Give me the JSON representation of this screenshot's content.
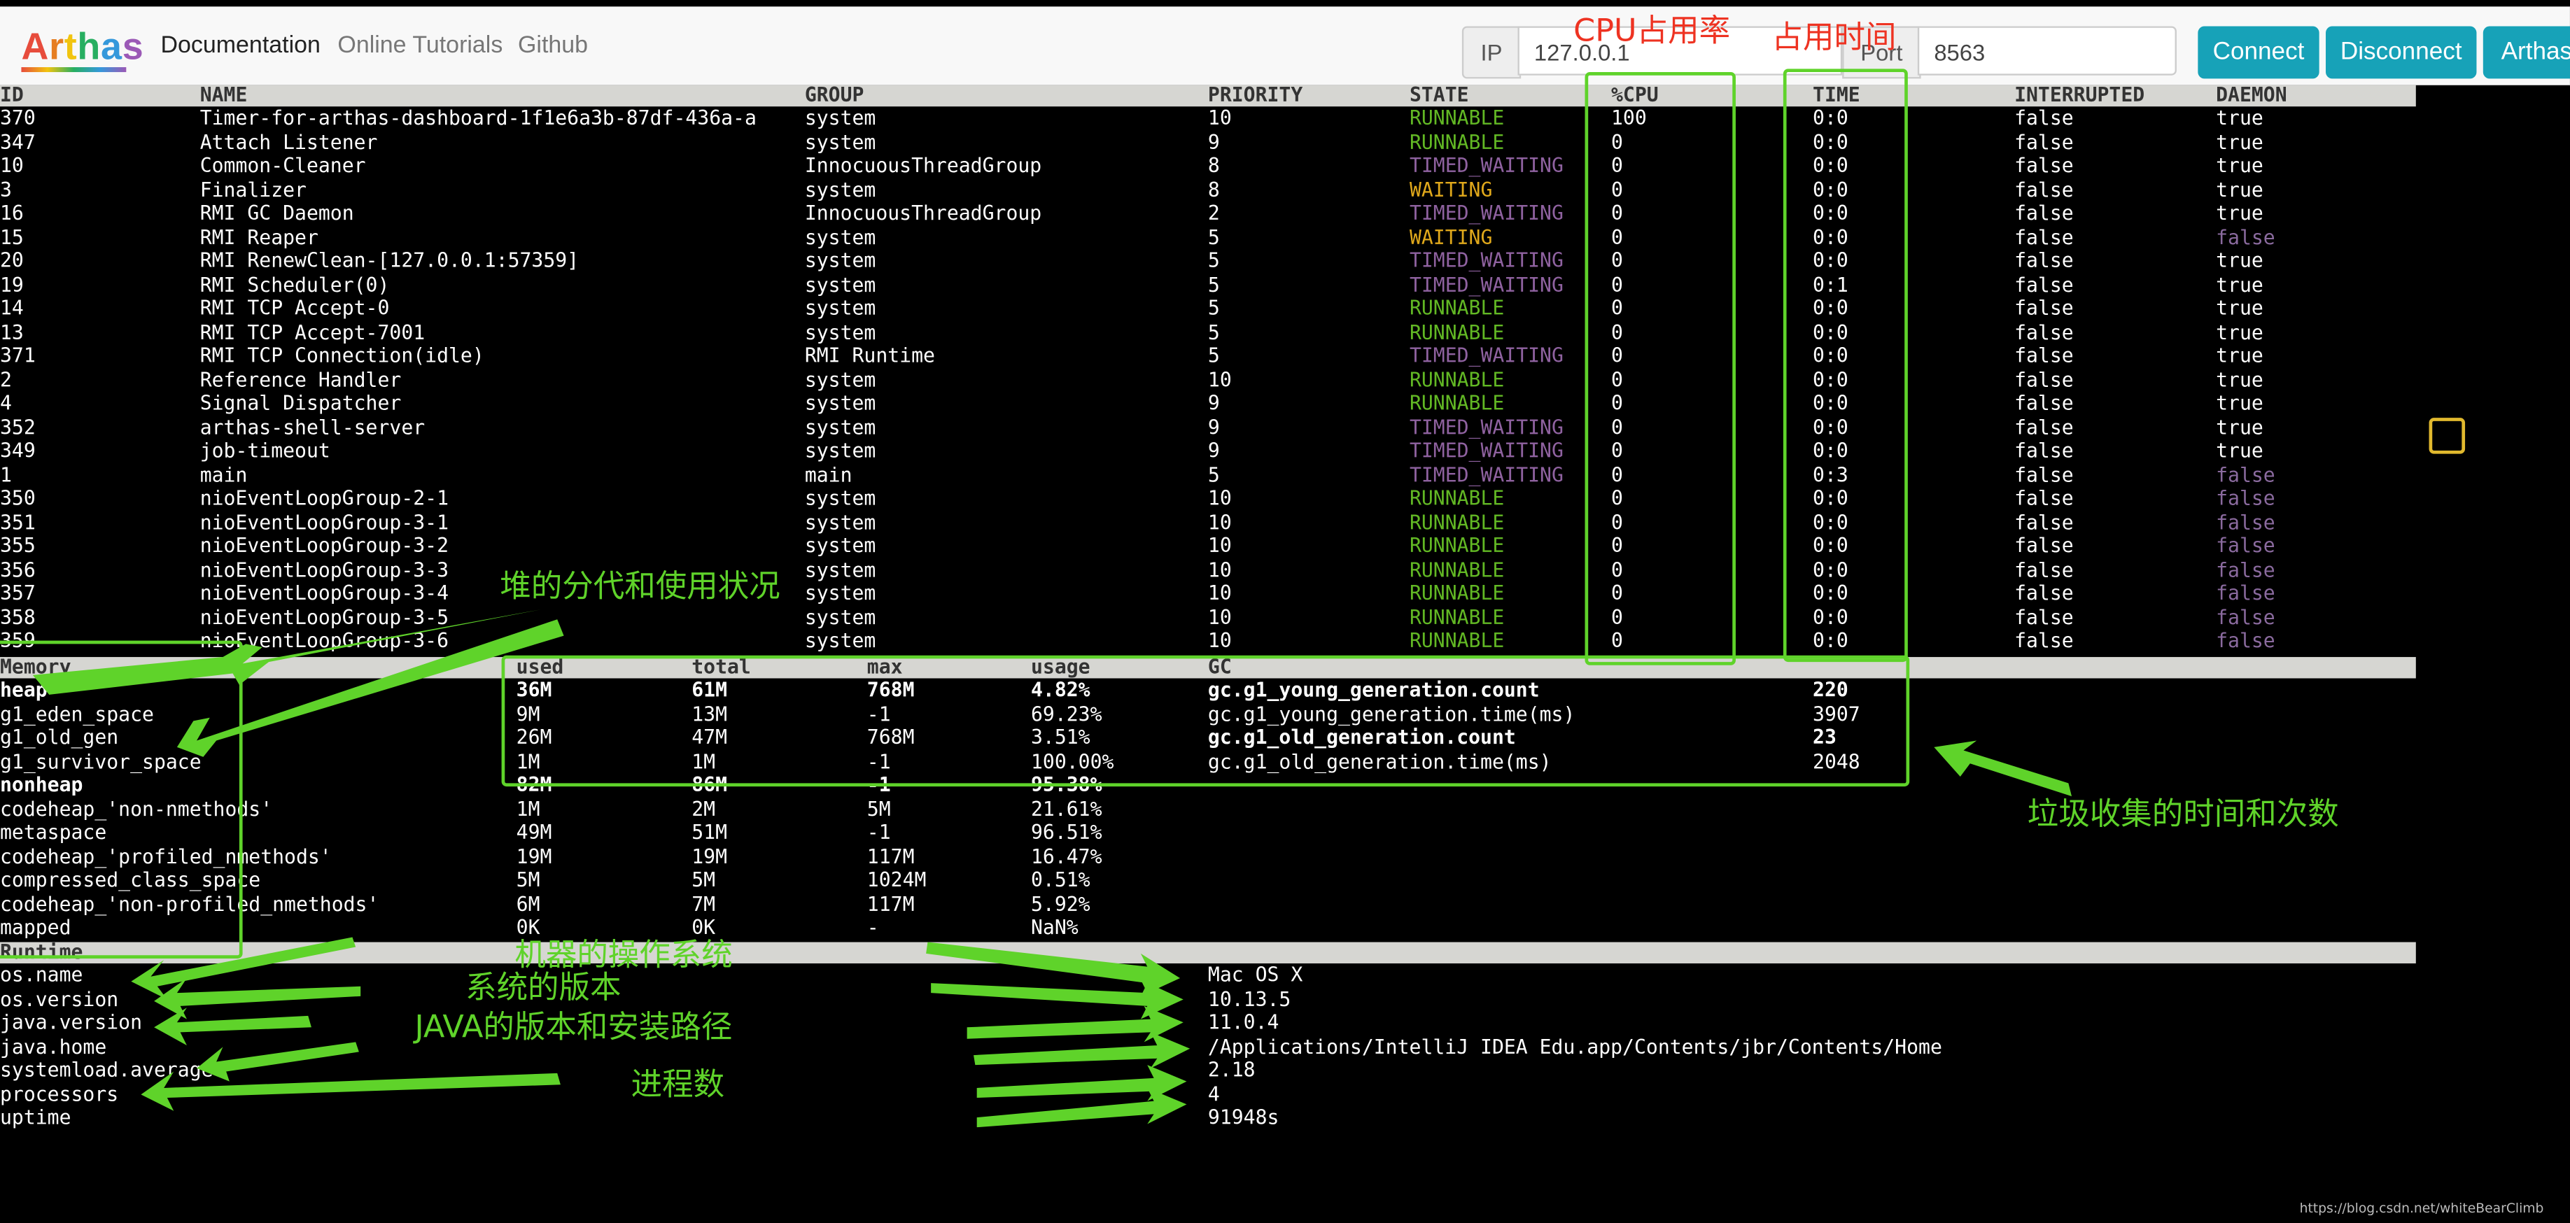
{
  "nav": {
    "logo": "Arthas",
    "links": [
      "Documentation",
      "Online Tutorials",
      "Github"
    ],
    "ip_label": "IP",
    "ip_value": "127.0.0.1",
    "port_label": "Port",
    "port_value": "8563",
    "buttons": [
      "Connect",
      "Disconnect",
      "Arthas"
    ]
  },
  "threads": {
    "headers": [
      "ID",
      "NAME",
      "GROUP",
      "PRIORITY",
      "STATE",
      "%CPU",
      "TIME",
      "INTERRUPTED",
      "DAEMON"
    ],
    "rows": [
      [
        "370",
        "Timer-for-arthas-dashboard-1f1e6a3b-87df-436a-a",
        "system",
        "10",
        "RUNNABLE",
        "100",
        "0:0",
        "false",
        "true"
      ],
      [
        "347",
        "Attach Listener",
        "system",
        "9",
        "RUNNABLE",
        "0",
        "0:0",
        "false",
        "true"
      ],
      [
        "10",
        "Common-Cleaner",
        "InnocuousThreadGroup",
        "8",
        "TIMED_WAITING",
        "0",
        "0:0",
        "false",
        "true"
      ],
      [
        "3",
        "Finalizer",
        "system",
        "8",
        "WAITING",
        "0",
        "0:0",
        "false",
        "true"
      ],
      [
        "16",
        "RMI GC Daemon",
        "InnocuousThreadGroup",
        "2",
        "TIMED_WAITING",
        "0",
        "0:0",
        "false",
        "true"
      ],
      [
        "15",
        "RMI Reaper",
        "system",
        "5",
        "WAITING",
        "0",
        "0:0",
        "false",
        "false"
      ],
      [
        "20",
        "RMI RenewClean-[127.0.0.1:57359]",
        "system",
        "5",
        "TIMED_WAITING",
        "0",
        "0:0",
        "false",
        "true"
      ],
      [
        "19",
        "RMI Scheduler(0)",
        "system",
        "5",
        "TIMED_WAITING",
        "0",
        "0:1",
        "false",
        "true"
      ],
      [
        "14",
        "RMI TCP Accept-0",
        "system",
        "5",
        "RUNNABLE",
        "0",
        "0:0",
        "false",
        "true"
      ],
      [
        "13",
        "RMI TCP Accept-7001",
        "system",
        "5",
        "RUNNABLE",
        "0",
        "0:0",
        "false",
        "true"
      ],
      [
        "371",
        "RMI TCP Connection(idle)",
        "RMI Runtime",
        "5",
        "TIMED_WAITING",
        "0",
        "0:0",
        "false",
        "true"
      ],
      [
        "2",
        "Reference Handler",
        "system",
        "10",
        "RUNNABLE",
        "0",
        "0:0",
        "false",
        "true"
      ],
      [
        "4",
        "Signal Dispatcher",
        "system",
        "9",
        "RUNNABLE",
        "0",
        "0:0",
        "false",
        "true"
      ],
      [
        "352",
        "arthas-shell-server",
        "system",
        "9",
        "TIMED_WAITING",
        "0",
        "0:0",
        "false",
        "true"
      ],
      [
        "349",
        "job-timeout",
        "system",
        "9",
        "TIMED_WAITING",
        "0",
        "0:0",
        "false",
        "true"
      ],
      [
        "1",
        "main",
        "main",
        "5",
        "TIMED_WAITING",
        "0",
        "0:3",
        "false",
        "false"
      ],
      [
        "350",
        "nioEventLoopGroup-2-1",
        "system",
        "10",
        "RUNNABLE",
        "0",
        "0:0",
        "false",
        "false"
      ],
      [
        "351",
        "nioEventLoopGroup-3-1",
        "system",
        "10",
        "RUNNABLE",
        "0",
        "0:0",
        "false",
        "false"
      ],
      [
        "355",
        "nioEventLoopGroup-3-2",
        "system",
        "10",
        "RUNNABLE",
        "0",
        "0:0",
        "false",
        "false"
      ],
      [
        "356",
        "nioEventLoopGroup-3-3",
        "system",
        "10",
        "RUNNABLE",
        "0",
        "0:0",
        "false",
        "false"
      ],
      [
        "357",
        "nioEventLoopGroup-3-4",
        "system",
        "10",
        "RUNNABLE",
        "0",
        "0:0",
        "false",
        "false"
      ],
      [
        "358",
        "nioEventLoopGroup-3-5",
        "system",
        "10",
        "RUNNABLE",
        "0",
        "0:0",
        "false",
        "false"
      ],
      [
        "359",
        "nioEventLoopGroup-3-6",
        "system",
        "10",
        "RUNNABLE",
        "0",
        "0:0",
        "false",
        "false"
      ]
    ]
  },
  "memory": {
    "headers": [
      "Memory",
      "used",
      "total",
      "max",
      "usage",
      "GC"
    ],
    "rows": [
      {
        "name": "heap",
        "used": "36M",
        "total": "61M",
        "max": "768M",
        "usage": "4.82%",
        "bold": true
      },
      {
        "name": "g1_eden_space",
        "used": "9M",
        "total": "13M",
        "max": "-1",
        "usage": "69.23%",
        "bold": false
      },
      {
        "name": "g1_old_gen",
        "used": "26M",
        "total": "47M",
        "max": "768M",
        "usage": "3.51%",
        "bold": false
      },
      {
        "name": "g1_survivor_space",
        "used": "1M",
        "total": "1M",
        "max": "-1",
        "usage": "100.00%",
        "bold": false
      },
      {
        "name": "nonheap",
        "used": "82M",
        "total": "86M",
        "max": "-1",
        "usage": "95.38%",
        "bold": true
      },
      {
        "name": "codeheap_'non-nmethods'",
        "used": "1M",
        "total": "2M",
        "max": "5M",
        "usage": "21.61%",
        "bold": false
      },
      {
        "name": "metaspace",
        "used": "49M",
        "total": "51M",
        "max": "-1",
        "usage": "96.51%",
        "bold": false
      },
      {
        "name": "codeheap_'profiled_nmethods'",
        "used": "19M",
        "total": "19M",
        "max": "117M",
        "usage": "16.47%",
        "bold": false
      },
      {
        "name": "compressed_class_space",
        "used": "5M",
        "total": "5M",
        "max": "1024M",
        "usage": "0.51%",
        "bold": false
      },
      {
        "name": "codeheap_'non-profiled_nmethods'",
        "used": "6M",
        "total": "7M",
        "max": "117M",
        "usage": "5.92%",
        "bold": false
      },
      {
        "name": "mapped",
        "used": "0K",
        "total": "0K",
        "max": "-",
        "usage": "NaN%",
        "bold": false
      }
    ],
    "gc": [
      {
        "name": "gc.g1_young_generation.count",
        "value": "220",
        "bold": true
      },
      {
        "name": "gc.g1_young_generation.time(ms)",
        "value": "3907",
        "bold": false
      },
      {
        "name": "gc.g1_old_generation.count",
        "value": "23",
        "bold": true
      },
      {
        "name": "gc.g1_old_generation.time(ms)",
        "value": "2048",
        "bold": false
      }
    ]
  },
  "runtime": {
    "header": "Runtime",
    "rows": [
      {
        "key": "os.name",
        "value": "Mac OS X"
      },
      {
        "key": "os.version",
        "value": "10.13.5"
      },
      {
        "key": "java.version",
        "value": "11.0.4"
      },
      {
        "key": "java.home",
        "value": "/Applications/IntelliJ IDEA Edu.app/Contents/jbr/Contents/Home"
      },
      {
        "key": "systemload.average",
        "value": "2.18"
      },
      {
        "key": "processors",
        "value": "4"
      },
      {
        "key": "uptime",
        "value": "91948s"
      }
    ]
  },
  "annotations": {
    "cpu": "CPU占用率",
    "time": "占用时间",
    "heap": "堆的分代和使用状况",
    "gc": "垃圾收集的时间和次数",
    "os": "机器的操作系统",
    "osver": "系统的版本",
    "java": "JAVA的版本和安装路径",
    "proc": "进程数"
  },
  "watermark": "https://blog.csdn.net/whiteBearClimb",
  "colors": {
    "runnable": "#62b824",
    "waiting": "#e0a81b",
    "timed_waiting": "#8f62a0",
    "annotation": "#5fd32a",
    "annotation_red": "#ee3322",
    "button": "#17a2b8"
  }
}
